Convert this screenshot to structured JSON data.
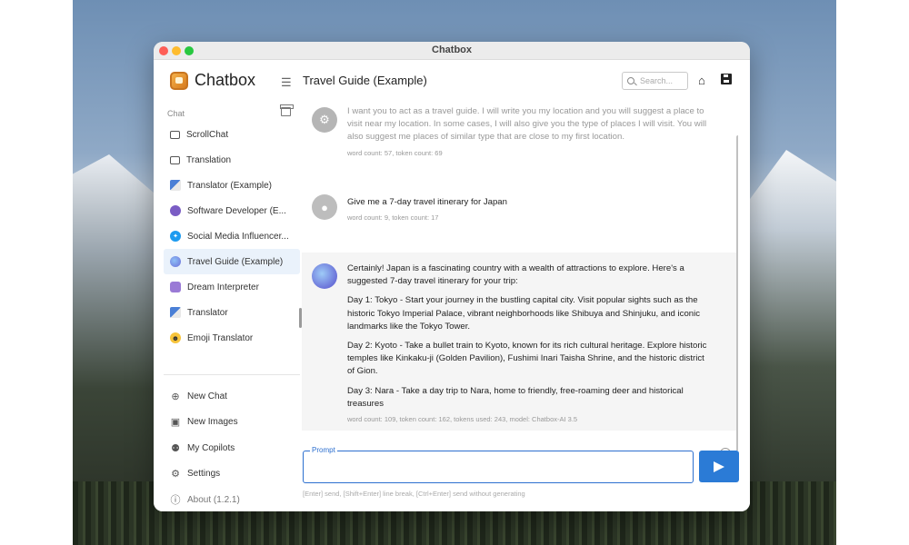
{
  "window": {
    "title": "Chatbox"
  },
  "sidebar": {
    "brand": "Chatbox",
    "section_label": "Chat",
    "items": [
      {
        "label": "ScrollChat",
        "icon": "chat-bubble-icon"
      },
      {
        "label": "Translation",
        "icon": "chat-bubble-icon"
      },
      {
        "label": "Translator (Example)",
        "icon": "translate-icon"
      },
      {
        "label": "Software Developer (E...",
        "icon": "developer-avatar-icon"
      },
      {
        "label": "Social Media Influencer...",
        "icon": "twitter-icon"
      },
      {
        "label": "Travel Guide (Example)",
        "icon": "globe-avatar-icon"
      },
      {
        "label": "Dream Interpreter",
        "icon": "dream-avatar-icon"
      },
      {
        "label": "Translator",
        "icon": "translate-icon"
      },
      {
        "label": "Emoji Translator",
        "icon": "emoji-icon"
      }
    ],
    "active_index": 5,
    "menu": [
      {
        "label": "New Chat",
        "icon": "plus-circle-icon"
      },
      {
        "label": "New Images",
        "icon": "image-icon"
      },
      {
        "label": "My Copilots",
        "icon": "robot-icon"
      },
      {
        "label": "Settings",
        "icon": "gear-icon"
      },
      {
        "label": "About (1.2.1)",
        "icon": "info-icon"
      }
    ]
  },
  "header": {
    "title": "Travel Guide (Example)",
    "search_placeholder": "Search..."
  },
  "messages": [
    {
      "role": "system",
      "text": "I want you to act as a travel guide. I will write you my location and you will suggest a place to visit near my location. In some cases, I will also give you the type of places I will visit. You will also suggest me places of similar type that are close to my first location.",
      "meta": "word count: 57, token count: 69"
    },
    {
      "role": "user",
      "text": "Give me a 7-day travel itinerary for Japan",
      "meta": "word count: 9, token count: 17"
    },
    {
      "role": "assistant",
      "paragraphs": [
        "Certainly! Japan is a fascinating country with a wealth of attractions to explore. Here's a suggested 7-day travel itinerary for your trip:",
        "Day 1: Tokyo - Start your journey in the bustling capital city. Visit popular sights such as the historic Tokyo Imperial Palace, vibrant neighborhoods like Shibuya and Shinjuku, and iconic landmarks like the Tokyo Tower.",
        "Day 2: Kyoto - Take a bullet train to Kyoto, known for its rich cultural heritage. Explore historic temples like Kinkaku-ji (Golden Pavilion), Fushimi Inari Taisha Shrine, and the historic district of Gion.",
        "Day 3: Nara - Take a day trip to Nara, home to friendly, free-roaming deer and historical treasures"
      ],
      "meta": "word count: 109, token count: 162, tokens used: 243, model: Chatbox-AI 3.5"
    }
  ],
  "composer": {
    "label": "Prompt",
    "value": "",
    "hint": "[Enter] send, [Shift+Enter] line break, [Ctrl+Enter] send without generating"
  },
  "colors": {
    "accent": "#2b7bd6",
    "active_item_bg": "#eaf2fb"
  }
}
